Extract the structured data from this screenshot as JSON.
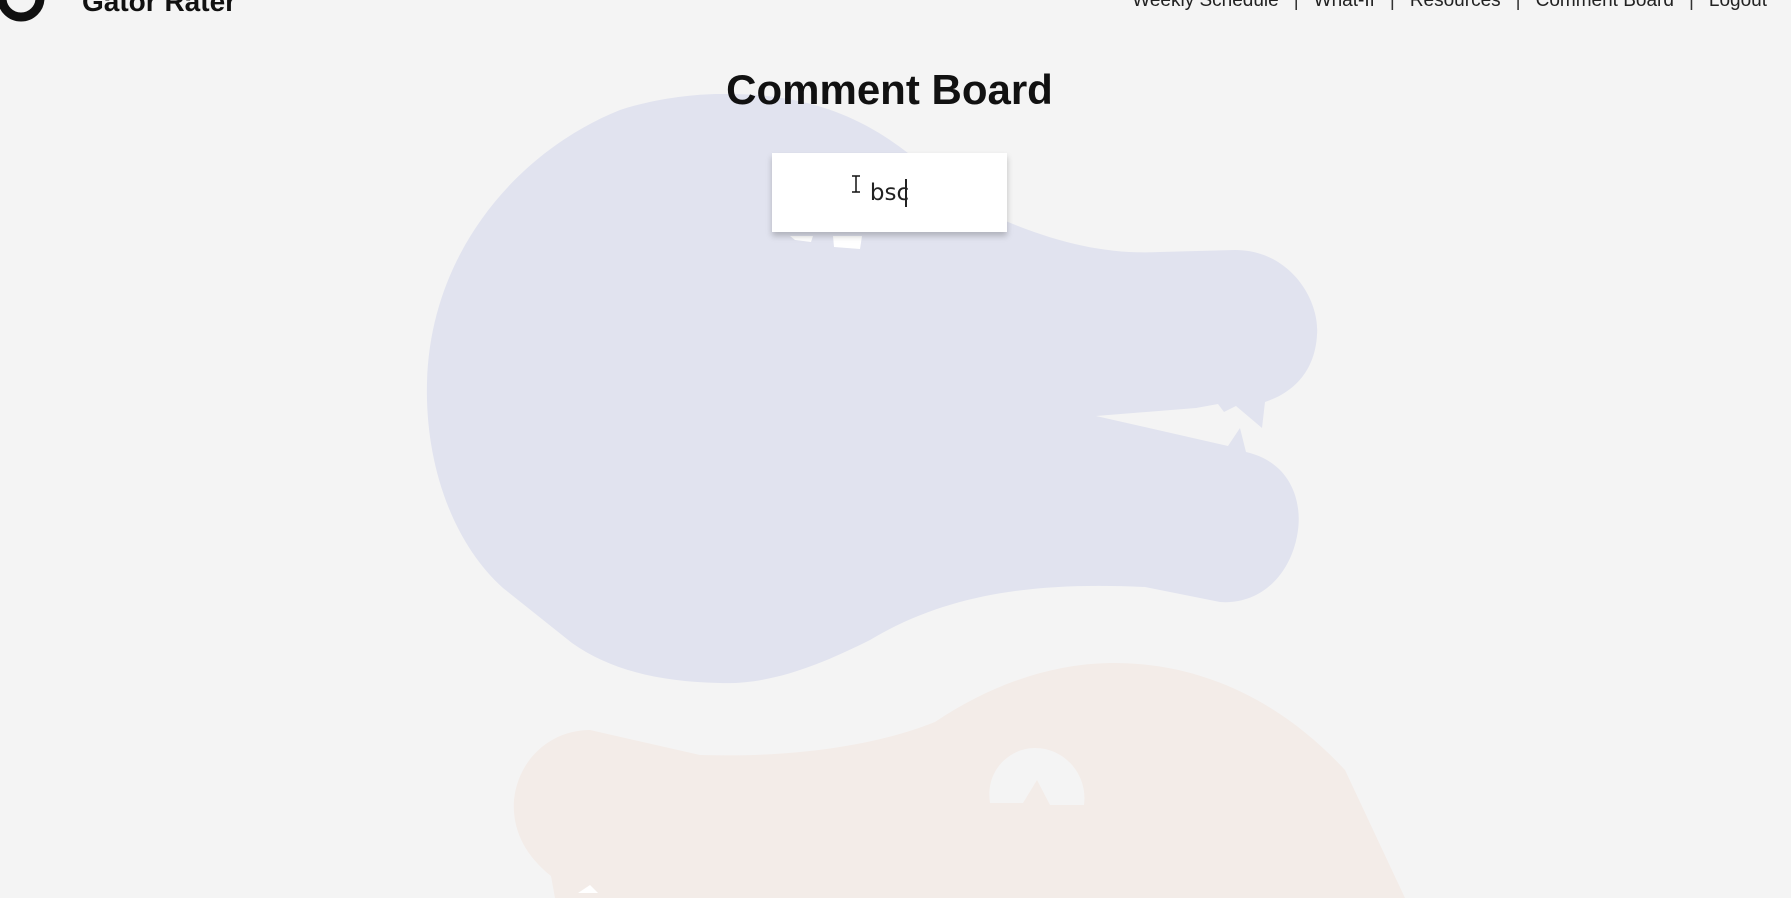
{
  "header": {
    "brand": "Gator Rater",
    "logo_icon": "gator-logo-icon",
    "nav": [
      {
        "label": "Weekly Schedule"
      },
      {
        "label": "What-If"
      },
      {
        "label": "Resources"
      },
      {
        "label": "Comment Board"
      },
      {
        "label": "Logout"
      }
    ],
    "separator": "|"
  },
  "main": {
    "title": "Comment Board",
    "comment_input": {
      "value": "bsc",
      "placeholder": ""
    }
  },
  "colors": {
    "background": "#f4f4f4",
    "gator_top": "#e1e3ef",
    "gator_bottom": "#f3ece8",
    "text": "#111111"
  }
}
